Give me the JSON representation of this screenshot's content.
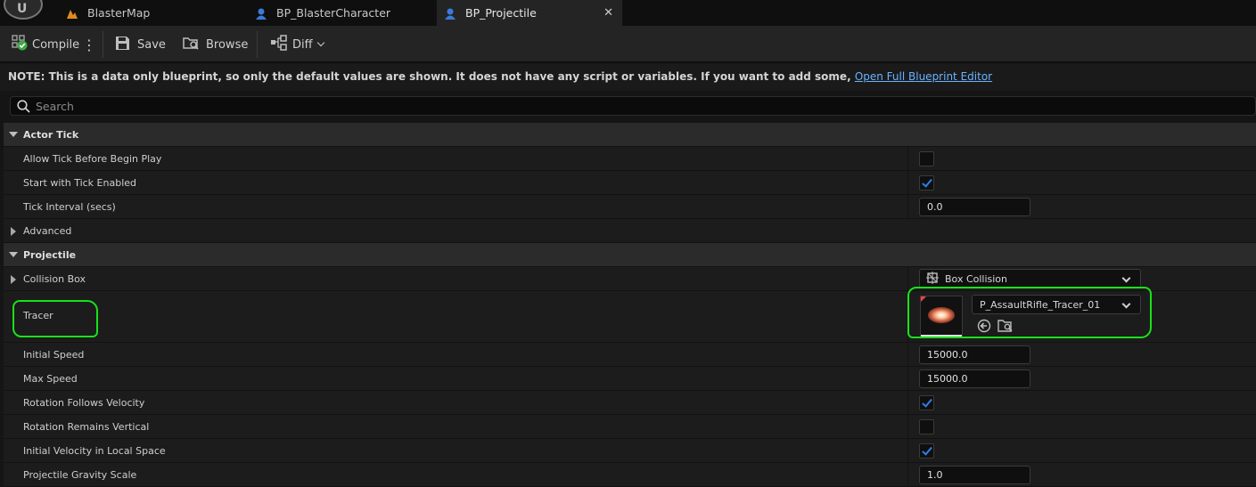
{
  "tabs": [
    {
      "label": "BlasterMap",
      "icon": "map-icon"
    },
    {
      "label": "BP_BlasterCharacter",
      "icon": "character-blueprint-icon"
    },
    {
      "label": "BP_Projectile",
      "icon": "character-blueprint-icon",
      "active": true
    }
  ],
  "toolbar": {
    "compile": "Compile",
    "save": "Save",
    "browse": "Browse",
    "diff": "Diff"
  },
  "note": {
    "text": "NOTE: This is a data only blueprint, so only the default values are shown.  It does not have any script or variables.  If you want to add some,",
    "link": "Open Full Blueprint Editor"
  },
  "search": {
    "placeholder": "Search",
    "value": ""
  },
  "categories": {
    "actor_tick": "Actor Tick",
    "projectile": "Projectile"
  },
  "rows": {
    "allow_tick": {
      "label": "Allow Tick Before Begin Play",
      "checked": false
    },
    "start_tick": {
      "label": "Start with Tick Enabled",
      "checked": true
    },
    "tick_interval": {
      "label": "Tick Interval (secs)",
      "value": "0.0"
    },
    "advanced": {
      "label": "Advanced"
    },
    "collision_box": {
      "label": "Collision Box",
      "value": "Box Collision"
    },
    "tracer": {
      "label": "Tracer",
      "value": "P_AssaultRifle_Tracer_01"
    },
    "initial_speed": {
      "label": "Initial Speed",
      "value": "15000.0"
    },
    "max_speed": {
      "label": "Max Speed",
      "value": "15000.0"
    },
    "rotation_follows": {
      "label": "Rotation Follows Velocity",
      "checked": true
    },
    "rotation_vertical": {
      "label": "Rotation Remains Vertical",
      "checked": false
    },
    "initial_velocity_local": {
      "label": "Initial Velocity in Local Space",
      "checked": true
    },
    "gravity_scale": {
      "label": "Projectile Gravity Scale",
      "value": "1.0"
    }
  },
  "colors": {
    "accent": "#2f7fe6",
    "annotation": "#19e219",
    "link": "#6bb2ff"
  }
}
